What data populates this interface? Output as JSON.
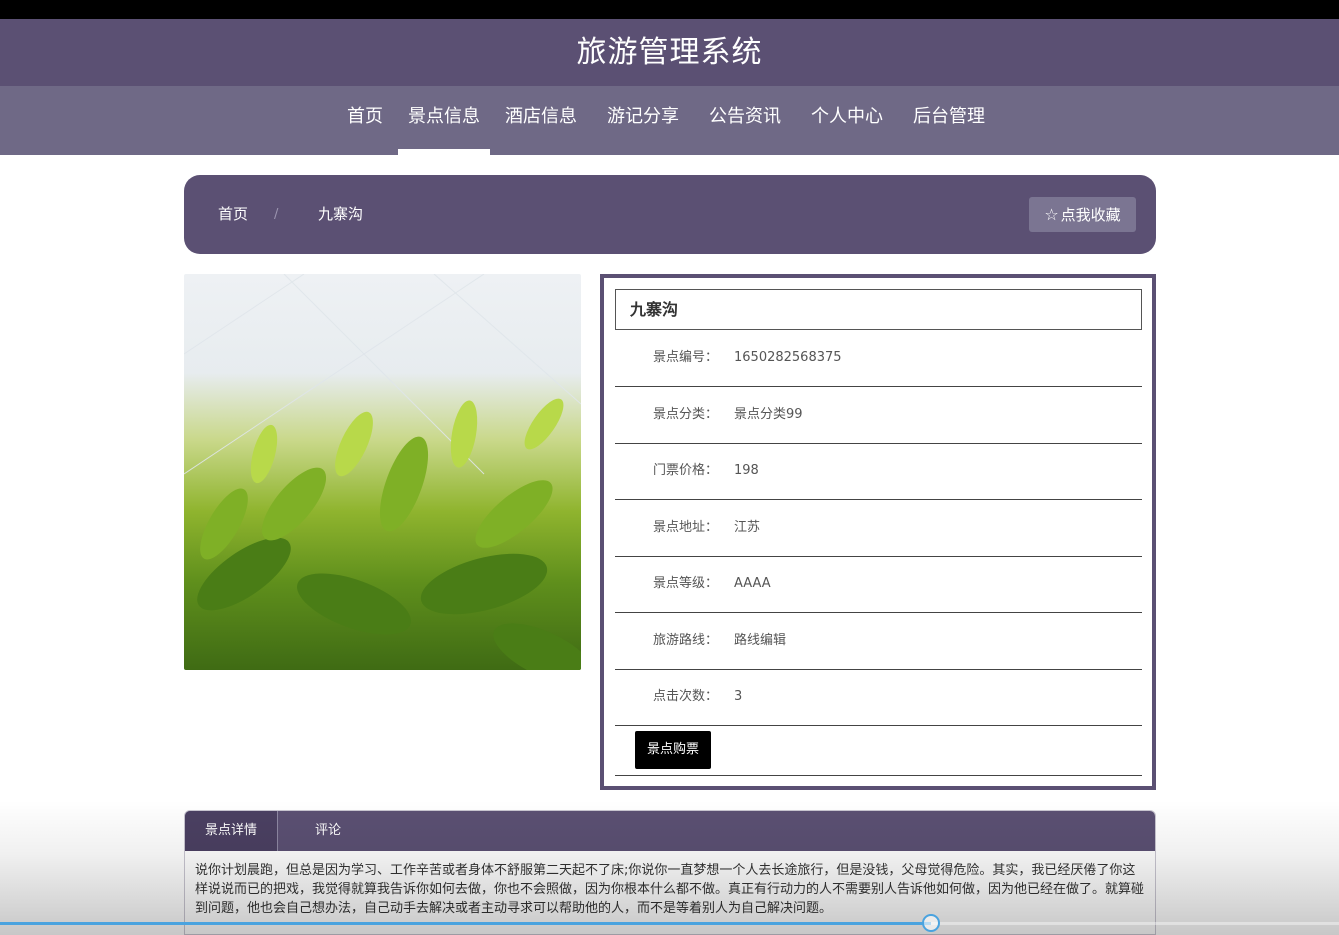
{
  "header": {
    "title": "旅游管理系统"
  },
  "nav": {
    "items": [
      {
        "label": "首页"
      },
      {
        "label": "景点信息",
        "active": true
      },
      {
        "label": "酒店信息"
      },
      {
        "label": "游记分享"
      },
      {
        "label": "公告资讯"
      },
      {
        "label": "个人中心"
      },
      {
        "label": "后台管理"
      }
    ]
  },
  "breadcrumb": {
    "home": "首页",
    "separator": "/",
    "current": "九寨沟",
    "favorite_label": "点我收藏",
    "favorite_icon": "star-outline-icon"
  },
  "attraction": {
    "name": "九寨沟",
    "fields": [
      {
        "label": "景点编号：",
        "value": "1650282568375"
      },
      {
        "label": "景点分类：",
        "value": "景点分类99"
      },
      {
        "label": "门票价格：",
        "value": "198"
      },
      {
        "label": "景点地址：",
        "value": "江苏"
      },
      {
        "label": "景点等级：",
        "value": "AAAA"
      },
      {
        "label": "旅游路线：",
        "value": "路线编辑"
      },
      {
        "label": "点击次数：",
        "value": "3"
      }
    ],
    "buy_label": "景点购票"
  },
  "tabs": {
    "items": [
      {
        "label": "景点详情",
        "active": true
      },
      {
        "label": "评论"
      }
    ],
    "content": "说你计划晨跑，但总是因为学习、工作辛苦或者身体不舒服第二天起不了床;你说你一直梦想一个人去长途旅行，但是没钱，父母觉得危险。其实，我已经厌倦了你这样说说而已的把戏，我觉得就算我告诉你如何去做，你也不会照做，因为你根本什么都不做。真正有行动力的人不需要别人告诉他如何做，因为他已经在做了。就算碰到问题，他也会自己想办法，自己动手去解决或者主动寻求可以帮助他的人，而不是等着别人为自己解决问题。"
  },
  "video": {
    "progress": 0.695
  },
  "colors": {
    "primary": "#5b5073",
    "nav": "#6f6986",
    "accent": "#4aa3df"
  }
}
